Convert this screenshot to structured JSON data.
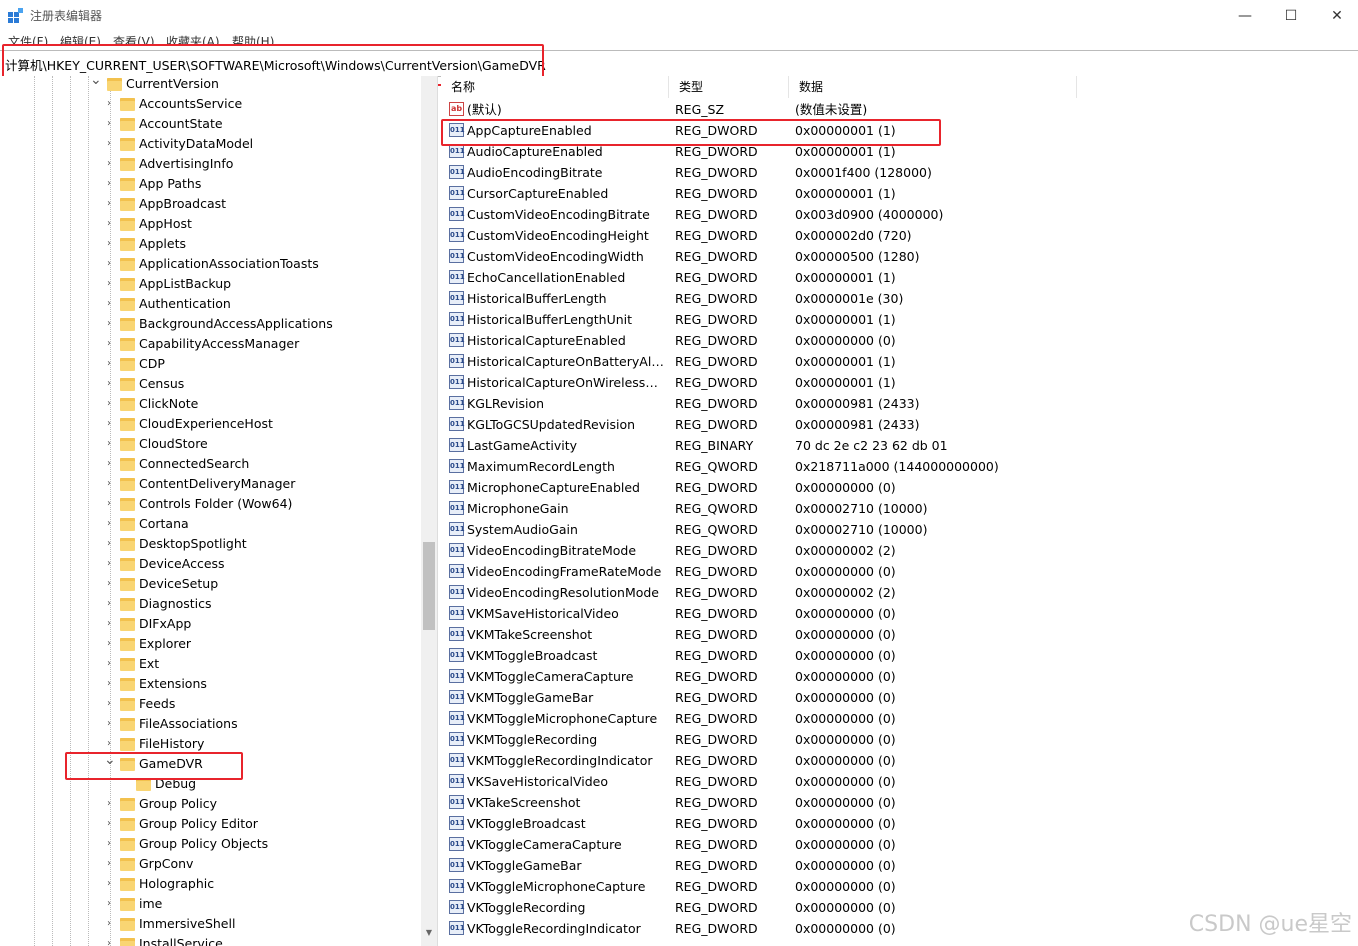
{
  "window": {
    "title": "注册表编辑器",
    "minimize": "—",
    "maximize": "☐",
    "close": "✕"
  },
  "menu": [
    "文件(F)",
    "编辑(E)",
    "查看(V)",
    "收藏夹(A)",
    "帮助(H)"
  ],
  "address": "计算机\\HKEY_CURRENT_USER\\SOFTWARE\\Microsoft\\Windows\\CurrentVersion\\GameDVR",
  "tree": {
    "parent": "CurrentVersion",
    "items": [
      "AccountsService",
      "AccountState",
      "ActivityDataModel",
      "AdvertisingInfo",
      "App Paths",
      "AppBroadcast",
      "AppHost",
      "Applets",
      "ApplicationAssociationToasts",
      "AppListBackup",
      "Authentication",
      "BackgroundAccessApplications",
      "CapabilityAccessManager",
      "CDP",
      "Census",
      "ClickNote",
      "CloudExperienceHost",
      "CloudStore",
      "ConnectedSearch",
      "ContentDeliveryManager",
      "Controls Folder (Wow64)",
      "Cortana",
      "DesktopSpotlight",
      "DeviceAccess",
      "DeviceSetup",
      "Diagnostics",
      "DIFxApp",
      "Explorer",
      "Ext",
      "Extensions",
      "Feeds",
      "FileAssociations",
      "FileHistory",
      "GameDVR"
    ],
    "child": "Debug",
    "after": [
      "Group Policy",
      "Group Policy Editor",
      "Group Policy Objects",
      "GrpConv",
      "Holographic",
      "ime",
      "ImmersiveShell",
      "InstallService"
    ]
  },
  "columns": {
    "name": "名称",
    "type": "类型",
    "data": "数据"
  },
  "values": [
    {
      "name": "(默认)",
      "type": "REG_SZ",
      "data": "(数值未设置)",
      "icon": "ab"
    },
    {
      "name": "AppCaptureEnabled",
      "type": "REG_DWORD",
      "data": "0x00000001 (1)",
      "icon": "bin"
    },
    {
      "name": "AudioCaptureEnabled",
      "type": "REG_DWORD",
      "data": "0x00000001 (1)",
      "icon": "bin"
    },
    {
      "name": "AudioEncodingBitrate",
      "type": "REG_DWORD",
      "data": "0x0001f400 (128000)",
      "icon": "bin"
    },
    {
      "name": "CursorCaptureEnabled",
      "type": "REG_DWORD",
      "data": "0x00000001 (1)",
      "icon": "bin"
    },
    {
      "name": "CustomVideoEncodingBitrate",
      "type": "REG_DWORD",
      "data": "0x003d0900 (4000000)",
      "icon": "bin"
    },
    {
      "name": "CustomVideoEncodingHeight",
      "type": "REG_DWORD",
      "data": "0x000002d0 (720)",
      "icon": "bin"
    },
    {
      "name": "CustomVideoEncodingWidth",
      "type": "REG_DWORD",
      "data": "0x00000500 (1280)",
      "icon": "bin"
    },
    {
      "name": "EchoCancellationEnabled",
      "type": "REG_DWORD",
      "data": "0x00000001 (1)",
      "icon": "bin"
    },
    {
      "name": "HistoricalBufferLength",
      "type": "REG_DWORD",
      "data": "0x0000001e (30)",
      "icon": "bin"
    },
    {
      "name": "HistoricalBufferLengthUnit",
      "type": "REG_DWORD",
      "data": "0x00000001 (1)",
      "icon": "bin"
    },
    {
      "name": "HistoricalCaptureEnabled",
      "type": "REG_DWORD",
      "data": "0x00000000 (0)",
      "icon": "bin"
    },
    {
      "name": "HistoricalCaptureOnBatteryAllow...",
      "type": "REG_DWORD",
      "data": "0x00000001 (1)",
      "icon": "bin"
    },
    {
      "name": "HistoricalCaptureOnWirelessDis...",
      "type": "REG_DWORD",
      "data": "0x00000001 (1)",
      "icon": "bin"
    },
    {
      "name": "KGLRevision",
      "type": "REG_DWORD",
      "data": "0x00000981 (2433)",
      "icon": "bin"
    },
    {
      "name": "KGLToGCSUpdatedRevision",
      "type": "REG_DWORD",
      "data": "0x00000981 (2433)",
      "icon": "bin"
    },
    {
      "name": "LastGameActivity",
      "type": "REG_BINARY",
      "data": "70 dc 2e c2 23 62 db 01",
      "icon": "bin"
    },
    {
      "name": "MaximumRecordLength",
      "type": "REG_QWORD",
      "data": "0x218711a000 (144000000000)",
      "icon": "bin"
    },
    {
      "name": "MicrophoneCaptureEnabled",
      "type": "REG_DWORD",
      "data": "0x00000000 (0)",
      "icon": "bin"
    },
    {
      "name": "MicrophoneGain",
      "type": "REG_QWORD",
      "data": "0x00002710 (10000)",
      "icon": "bin"
    },
    {
      "name": "SystemAudioGain",
      "type": "REG_QWORD",
      "data": "0x00002710 (10000)",
      "icon": "bin"
    },
    {
      "name": "VideoEncodingBitrateMode",
      "type": "REG_DWORD",
      "data": "0x00000002 (2)",
      "icon": "bin"
    },
    {
      "name": "VideoEncodingFrameRateMode",
      "type": "REG_DWORD",
      "data": "0x00000000 (0)",
      "icon": "bin"
    },
    {
      "name": "VideoEncodingResolutionMode",
      "type": "REG_DWORD",
      "data": "0x00000002 (2)",
      "icon": "bin"
    },
    {
      "name": "VKMSaveHistoricalVideo",
      "type": "REG_DWORD",
      "data": "0x00000000 (0)",
      "icon": "bin"
    },
    {
      "name": "VKMTakeScreenshot",
      "type": "REG_DWORD",
      "data": "0x00000000 (0)",
      "icon": "bin"
    },
    {
      "name": "VKMToggleBroadcast",
      "type": "REG_DWORD",
      "data": "0x00000000 (0)",
      "icon": "bin"
    },
    {
      "name": "VKMToggleCameraCapture",
      "type": "REG_DWORD",
      "data": "0x00000000 (0)",
      "icon": "bin"
    },
    {
      "name": "VKMToggleGameBar",
      "type": "REG_DWORD",
      "data": "0x00000000 (0)",
      "icon": "bin"
    },
    {
      "name": "VKMToggleMicrophoneCapture",
      "type": "REG_DWORD",
      "data": "0x00000000 (0)",
      "icon": "bin"
    },
    {
      "name": "VKMToggleRecording",
      "type": "REG_DWORD",
      "data": "0x00000000 (0)",
      "icon": "bin"
    },
    {
      "name": "VKMToggleRecordingIndicator",
      "type": "REG_DWORD",
      "data": "0x00000000 (0)",
      "icon": "bin"
    },
    {
      "name": "VKSaveHistoricalVideo",
      "type": "REG_DWORD",
      "data": "0x00000000 (0)",
      "icon": "bin"
    },
    {
      "name": "VKTakeScreenshot",
      "type": "REG_DWORD",
      "data": "0x00000000 (0)",
      "icon": "bin"
    },
    {
      "name": "VKToggleBroadcast",
      "type": "REG_DWORD",
      "data": "0x00000000 (0)",
      "icon": "bin"
    },
    {
      "name": "VKToggleCameraCapture",
      "type": "REG_DWORD",
      "data": "0x00000000 (0)",
      "icon": "bin"
    },
    {
      "name": "VKToggleGameBar",
      "type": "REG_DWORD",
      "data": "0x00000000 (0)",
      "icon": "bin"
    },
    {
      "name": "VKToggleMicrophoneCapture",
      "type": "REG_DWORD",
      "data": "0x00000000 (0)",
      "icon": "bin"
    },
    {
      "name": "VKToggleRecording",
      "type": "REG_DWORD",
      "data": "0x00000000 (0)",
      "icon": "bin"
    },
    {
      "name": "VKToggleRecordingIndicator",
      "type": "REG_DWORD",
      "data": "0x00000000 (0)",
      "icon": "bin"
    }
  ],
  "watermark": "CSDN @ue星空",
  "colors": {
    "highlight_box": "#e8242c",
    "folder": "#f9d573"
  }
}
